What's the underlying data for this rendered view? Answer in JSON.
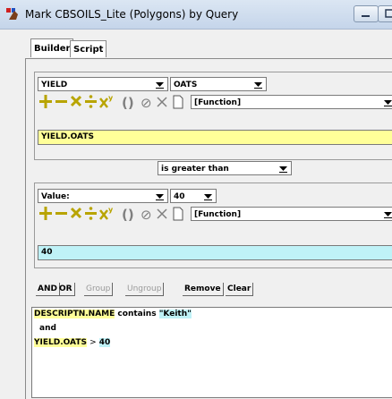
{
  "window": {
    "title": "Mark CBSOILS_Lite (Polygons) by Query"
  },
  "tabs": [
    {
      "label": "Builder"
    },
    {
      "label": "Script"
    }
  ],
  "left_expr": {
    "field_select": "YIELD",
    "value_select": "OATS",
    "function_select": "[Function]",
    "expression": "YIELD.OATS",
    "operators": [
      "+",
      "−",
      "×",
      "÷",
      "x²",
      "()",
      "≠",
      "×",
      "▯"
    ]
  },
  "comparison": {
    "selected": "is greater than"
  },
  "right_expr": {
    "field_select": "Value:",
    "value_select": "40",
    "function_select": "[Function]",
    "expression": "40"
  },
  "toolbar": {
    "and": "AND",
    "or": "OR",
    "group": "Group",
    "ungroup": "Ungroup",
    "remove": "Remove",
    "clear": "Clear"
  },
  "query": {
    "line1_field": "DESCRIPTN.NAME",
    "line1_op": "contains",
    "line1_value": "\"Keith\"",
    "line2": "and",
    "line3_field": "YIELD.OATS",
    "line3_op": ">",
    "line3_value": "40"
  },
  "colors": {
    "yellow_field": "#ffff99",
    "cyan_field": "#bff2f7",
    "op_plus": "#b8a400",
    "op_gray": "#7f7f7f"
  }
}
